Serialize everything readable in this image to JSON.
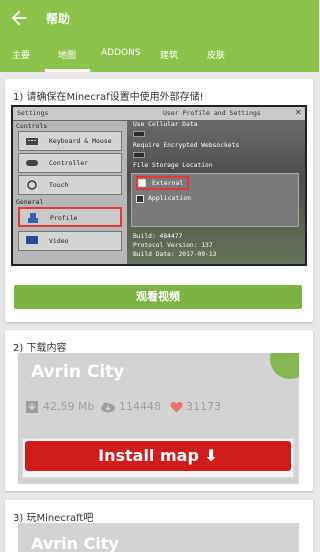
{
  "appbar": {
    "title": "帮助",
    "tabs": [
      {
        "label": "主要"
      },
      {
        "label": "地图"
      },
      {
        "label": "ADDONS"
      },
      {
        "label": "建筑"
      },
      {
        "label": "皮肤"
      }
    ],
    "active_tab": "地图",
    "color": "#8bc34a"
  },
  "card1": {
    "title": "1)  请确保在Minecraf设置中使用外部存储!",
    "screenshot": {
      "top_left": "Settings",
      "top_right": "User Profile and Settings",
      "close": "✕",
      "controls_header": "Controls",
      "controls": [
        "Keyboard & Mouse",
        "Controller",
        "Touch"
      ],
      "general_header": "General",
      "general": [
        "Profile",
        "Video"
      ],
      "right_lines": [
        "Use Cellular Data",
        "Require Encrypted Websockets",
        "File Storage Location"
      ],
      "storage_options": [
        "External",
        "Application"
      ],
      "build_lines": [
        "Build: 484477",
        "Protocol Version: 137",
        "Build Date: 2017-09-13"
      ]
    },
    "button": "观看视频"
  },
  "card2": {
    "title": "2)  下载内容",
    "map_name": "Avrin City",
    "size": "42,59 Mb",
    "downloads": "114448",
    "likes": "31173",
    "install": "Install map ⬇"
  },
  "card3": {
    "title": "3)  玩Minecraft吧",
    "map_name": "Avrin City"
  },
  "colors": {
    "accent": "#7cb342",
    "install": "#d11c1c",
    "highlight": "#e53935"
  }
}
